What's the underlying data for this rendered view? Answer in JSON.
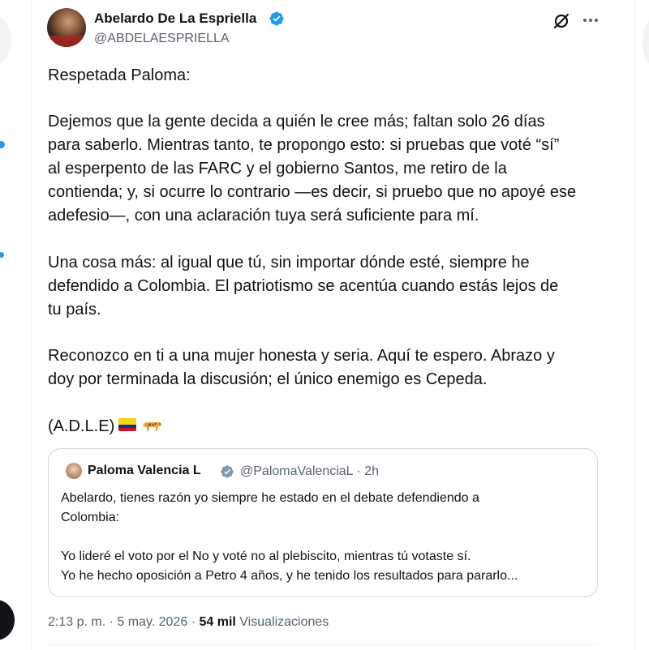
{
  "post": {
    "author_name": "Abelardo De La Espriella",
    "author_handle": "@ABDELAESPRIELLA",
    "body_lines": [
      "Respetada Paloma:",
      "Dejemos que la gente decida a quién le cree más; faltan solo 26 días",
      "para saberlo. Mientras tanto, te propongo esto: si pruebas que voté “sí”",
      "al esperpento de las FARC y el gobierno Santos, me retiro de la",
      "contienda; y, si ocurre lo contrario —es decir, si pruebo que no apoyé ese",
      "adefesio—, con una aclaración tuya será suficiente para mí.",
      "Una cosa más: al igual que tú, sin importar dónde esté, siempre he",
      "defendido a Colombia. El patriotismo se acentúa cuando estás lejos de",
      "tu país.",
      "Reconozco en ti a una mujer honesta y seria. Aquí te espero. Abrazo y",
      "doy por terminada la discusión; el único enemigo es Cepeda.",
      "(A.D.L.E)"
    ],
    "emoji_icons": [
      "colombia-flag-icon",
      "leopard-icon"
    ],
    "timestamp": "2:13 p. m. · 5 may. 2026",
    "separator": "·",
    "views_count": "54 mil",
    "views_label": "Visualizaciones"
  },
  "quoted": {
    "author_name": "Paloma Valencia L",
    "handle_time": "@PalomaValenciaL · 2h",
    "lines": [
      "Abelardo, tienes razón yo siempre he estado en el debate defendiendo a",
      "Colombia:",
      "Yo lideré el voto por el No y voté no al plebiscito, mientras tú votaste sí.",
      "Yo he hecho oposición a Petro 4 años, y he tenido los resultados para pararlo..."
    ]
  },
  "colors": {
    "accent": "#1d9bf0",
    "text": "#0f1419",
    "muted": "#536471",
    "border": "#cfd9de"
  }
}
